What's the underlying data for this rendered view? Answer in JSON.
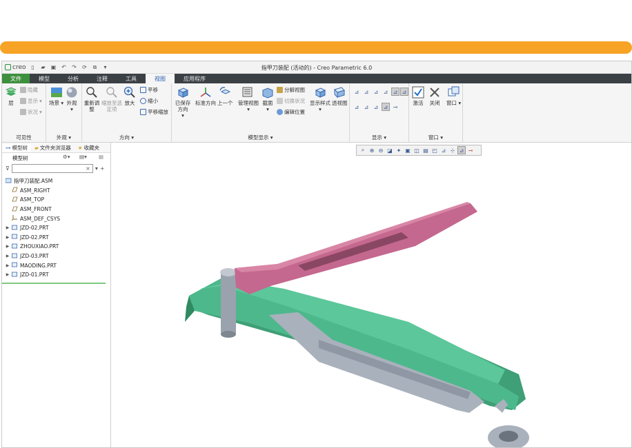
{
  "window": {
    "title": "指甲刀装配 (活动的) - Creo Parametric 6.0",
    "app_name": "creo"
  },
  "tabs": [
    "文件",
    "模型",
    "分析",
    "注释",
    "工具",
    "视图",
    "应用程序"
  ],
  "active_tab": "视图",
  "ribbon": {
    "visibility": {
      "label": "可见性",
      "layer": "层",
      "hide": "隐藏",
      "show": "显示",
      "status": "状况"
    },
    "appearance": {
      "label": "外观",
      "scene": "场景",
      "appearance": "外观"
    },
    "orientation": {
      "label": "方向",
      "refit": "重新调整",
      "zoom_to_selected": "缩放至选定项",
      "zoom_in": "放大",
      "zoom_out": "缩小",
      "pan": "平移",
      "pan_zoom": "平移缩放"
    },
    "model_display": {
      "label": "模型显示",
      "saved_orientations": "已保存方向",
      "standard_orientation": "标准方向",
      "previous": "上一个",
      "manage_views": "管理视图",
      "section": "截面",
      "exploded_view": "分解视图",
      "toggle_status": "切换状况",
      "edit_position": "编辑位置",
      "display_style": "显示样式",
      "perspective": "透视图"
    },
    "show": {
      "label": "显示"
    },
    "window": {
      "label": "窗口",
      "activate": "激活",
      "close": "关闭",
      "windows": "窗口"
    }
  },
  "left_panel": {
    "tabs": [
      "模型树",
      "文件夹浏览器",
      "收藏夹"
    ],
    "toolbar_label": "模型树",
    "search_placeholder": "",
    "tree": [
      {
        "label": "指甲刀装配.ASM",
        "type": "assembly",
        "expandable": false
      },
      {
        "label": "ASM_RIGHT",
        "type": "datum-plane",
        "expandable": false
      },
      {
        "label": "ASM_TOP",
        "type": "datum-plane",
        "expandable": false
      },
      {
        "label": "ASM_FRONT",
        "type": "datum-plane",
        "expandable": false
      },
      {
        "label": "ASM_DEF_CSYS",
        "type": "csys",
        "expandable": false
      },
      {
        "label": "JZD-02.PRT",
        "type": "part",
        "expandable": true
      },
      {
        "label": "JZD-02.PRT",
        "type": "part",
        "expandable": true
      },
      {
        "label": "ZHOUXIAO.PRT",
        "type": "part",
        "expandable": true
      },
      {
        "label": "JZD-03.PRT",
        "type": "part",
        "expandable": true
      },
      {
        "label": "MAODING.PRT",
        "type": "part",
        "expandable": true
      },
      {
        "label": "JZD-01.PRT",
        "type": "part",
        "expandable": true
      }
    ]
  },
  "colors": {
    "accent_bar": "#F7A325",
    "file_tab": "#3e8f3e",
    "tab_bar": "#3b4045",
    "body_green": "#4DB88C",
    "lever_pink": "#C4688F",
    "blade_gray": "#A9B1BC"
  }
}
